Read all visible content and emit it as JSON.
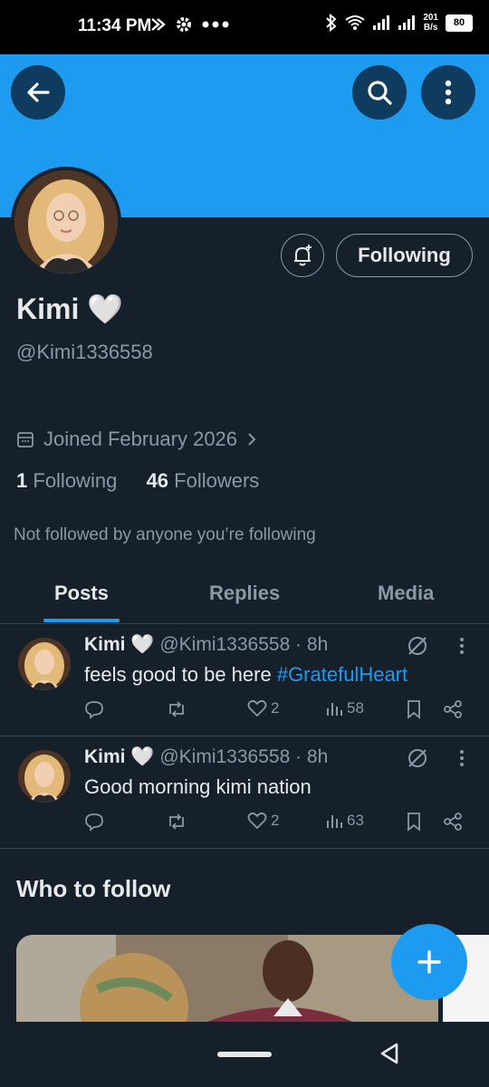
{
  "status_bar": {
    "time": "11:34 PM",
    "net_speed_value": "201",
    "net_speed_unit": "B/s",
    "battery": "80"
  },
  "profile": {
    "name": "Kimi 🤍",
    "handle": "@Kimi1336558",
    "joined": "Joined February 2026",
    "following_count": "1",
    "following_label": "Following",
    "followers_count": "46",
    "followers_label": "Followers",
    "not_followed": "Not followed by anyone you’re following",
    "following_button": "Following"
  },
  "tabs": [
    {
      "label": "Posts",
      "active": true
    },
    {
      "label": "Replies",
      "active": false
    },
    {
      "label": "Media",
      "active": false
    }
  ],
  "posts": [
    {
      "name": "Kimi 🤍",
      "handle_time": "@Kimi1336558 · 8h",
      "text": "feels good to be here ",
      "hashtag": "#GratefulHeart",
      "likes": "2",
      "views": "58"
    },
    {
      "name": "Kimi 🤍",
      "handle_time": "@Kimi1336558 · 8h",
      "text": "Good morning kimi nation",
      "hashtag": "",
      "likes": "2",
      "views": "63"
    }
  ],
  "who_to_follow": {
    "title": "Who to follow"
  },
  "colors": {
    "background": "#15202b",
    "banner": "#1d9bf0",
    "accent": "#1d9bf0",
    "muted_text": "#8b98a5"
  }
}
